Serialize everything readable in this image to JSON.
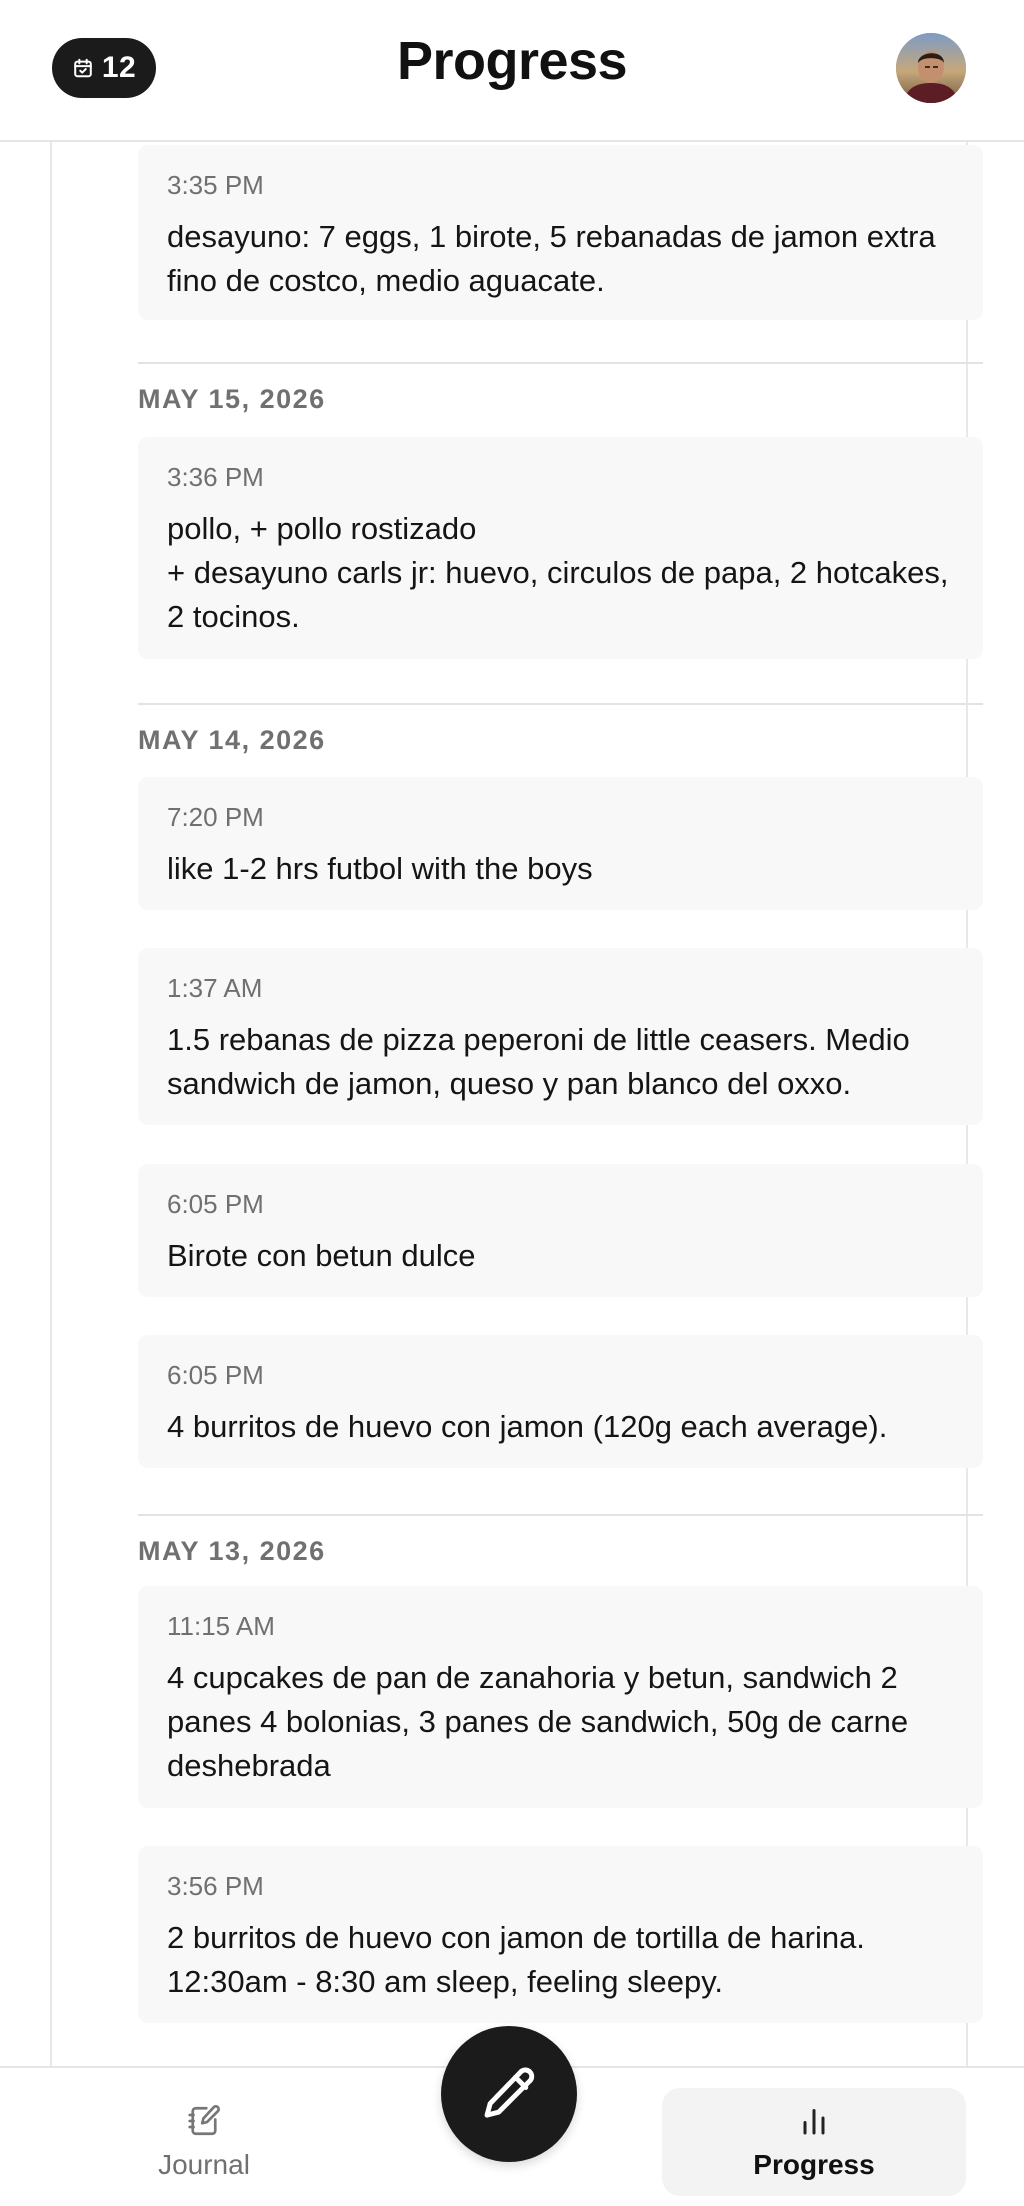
{
  "header": {
    "streak_count": "12",
    "title": "Progress"
  },
  "entries": [
    {
      "time": "3:35 PM",
      "text": "desayuno: 7 eggs, 1 birote, 5 rebanadas de jamon extra fino de costco, medio aguacate."
    },
    {
      "date": "MAY 15, 2026"
    },
    {
      "time": "3:36 PM",
      "text": "pollo, + pollo rostizado\n+ desayuno carls jr: huevo, circulos de papa, 2 hotcakes, 2 tocinos."
    },
    {
      "date": "MAY 14, 2026"
    },
    {
      "time": "7:20 PM",
      "text": "like 1-2 hrs futbol with the boys"
    },
    {
      "time": "1:37 AM",
      "text": "1.5 rebanas de pizza peperoni de little ceasers. Medio sandwich de jamon, queso y pan blanco del oxxo."
    },
    {
      "time": "6:05 PM",
      "text": "Birote con betun dulce"
    },
    {
      "time": "6:05 PM",
      "text": "4 burritos de huevo con jamon (120g each average)."
    },
    {
      "date": "MAY 13, 2026"
    },
    {
      "time": "11:15 AM",
      "text": "4 cupcakes de pan de zanahoria y betun, sandwich 2 panes 4 bolonias, 3 panes de sandwich, 50g de carne deshebrada"
    },
    {
      "time": "3:56 PM",
      "text": "2 burritos de huevo con jamon de tortilla de harina. 12:30am - 8:30 am sleep, feeling sleepy."
    }
  ],
  "nav": {
    "journal_label": "Journal",
    "progress_label": "Progress",
    "active": "progress"
  },
  "icons": {
    "streak": "calendar-check-icon",
    "fab": "pencil-icon",
    "journal": "notebook-pen-icon",
    "progress": "bar-chart-icon"
  },
  "colors": {
    "dark": "#1b1b1b",
    "card_bg": "#f8f8f8",
    "muted_text": "#707070"
  }
}
